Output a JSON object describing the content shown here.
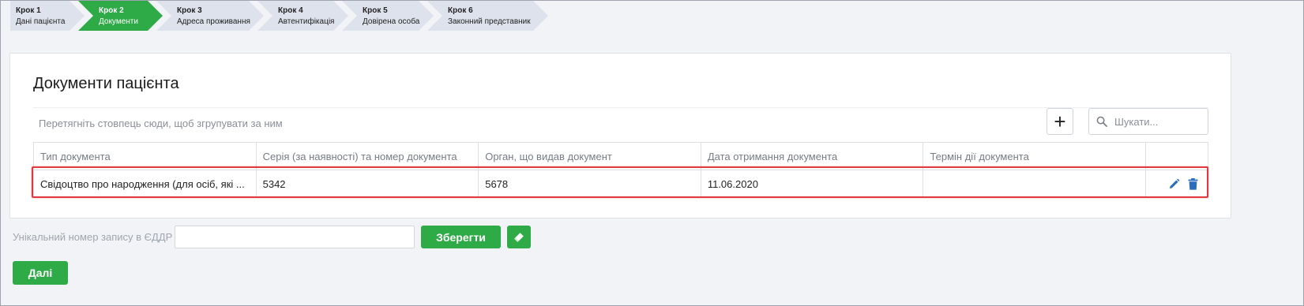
{
  "stepper": {
    "steps": [
      {
        "num": "Крок 1",
        "label": "Дані пацієнта",
        "active": false
      },
      {
        "num": "Крок 2",
        "label": "Документи",
        "active": true
      },
      {
        "num": "Крок 3",
        "label": "Адреса проживання",
        "active": false
      },
      {
        "num": "Крок 4",
        "label": "Автентифікація",
        "active": false
      },
      {
        "num": "Крок 5",
        "label": "Довірена особа",
        "active": false
      },
      {
        "num": "Крок 6",
        "label": "Законний представник",
        "active": false
      }
    ]
  },
  "card": {
    "title": "Документи пацієнта",
    "group_hint": "Перетягніть стовпець сюди, щоб згрупувати за ним",
    "add_label": "+",
    "search": {
      "placeholder": "Шукати...",
      "value": ""
    }
  },
  "grid": {
    "columns": [
      "Тип документа",
      "Серія (за наявності) та номер документа",
      "Орган, що видав документ",
      "Дата отримання документа",
      "Термін дії документа"
    ],
    "rows": [
      {
        "type": "Свідоцтво про народження (для осіб, які ...",
        "number": "5342",
        "issuer": "5678",
        "date": "11.06.2020",
        "expiry": ""
      }
    ]
  },
  "form": {
    "reg_label": "Унікальний номер запису в ЄДДР",
    "reg_value": "",
    "save_label": "Зберегти",
    "next_label": "Далі"
  },
  "colors": {
    "accent_green": "#2eaa46",
    "step_inactive": "#dde2ec",
    "highlight_red": "#e0393e",
    "action_blue": "#2a6dbb"
  },
  "icons": {
    "search": "search-icon",
    "edit": "pencil-icon",
    "delete": "trash-icon",
    "eraser": "eraser-icon"
  }
}
